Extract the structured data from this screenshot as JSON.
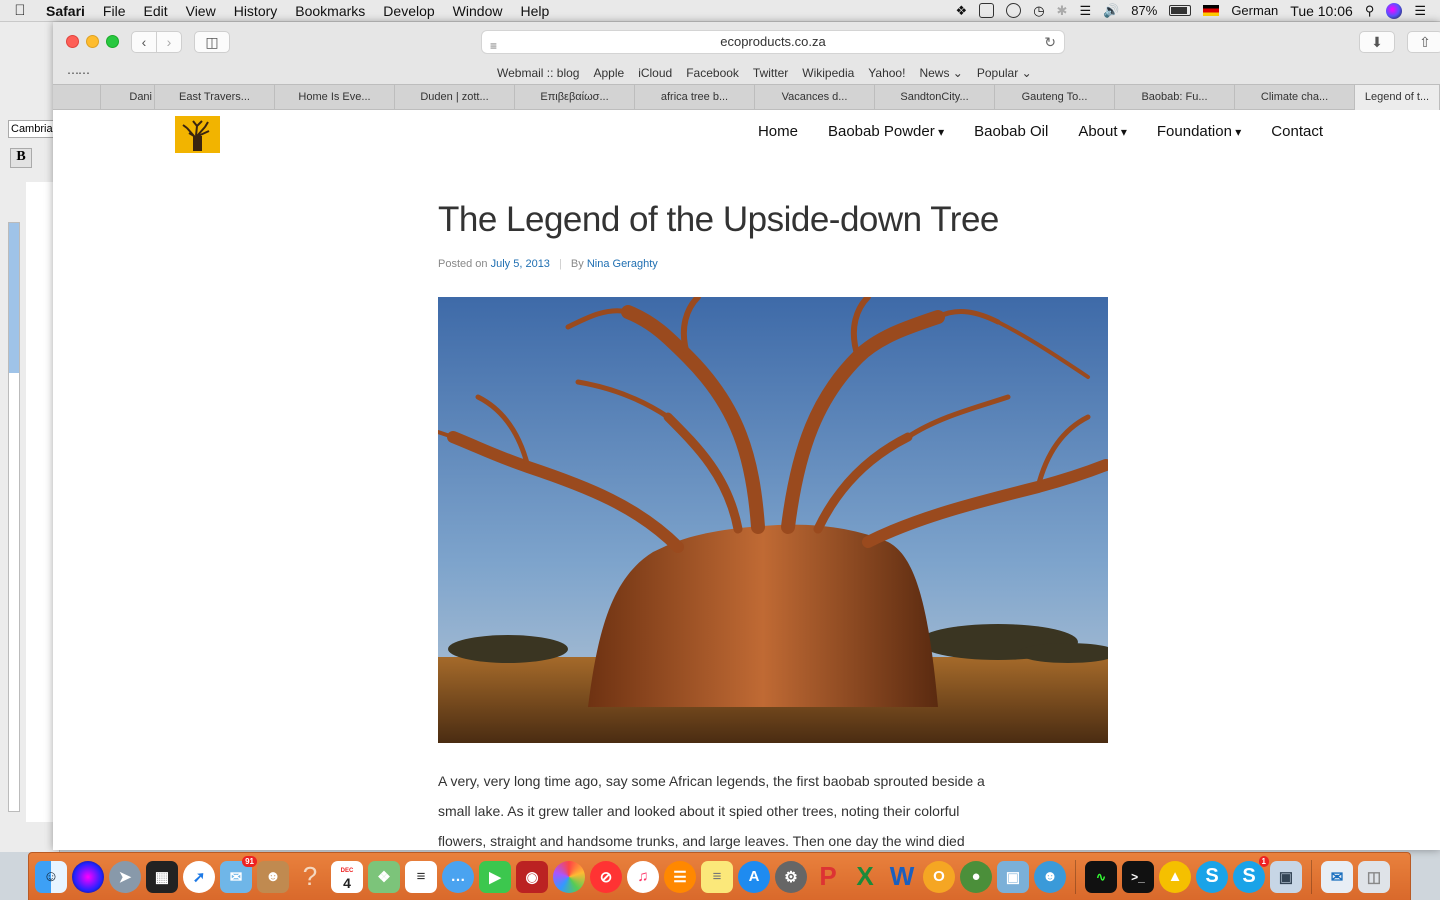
{
  "menubar": {
    "app_name": "Safari",
    "menus": [
      "File",
      "Edit",
      "View",
      "History",
      "Bookmarks",
      "Develop",
      "Window",
      "Help"
    ],
    "battery": "87%",
    "input_language": "German",
    "clock": "Tue 10:06"
  },
  "background_window": {
    "font_box": "Cambria",
    "bold_button": "B"
  },
  "browser": {
    "url": "ecoproducts.co.za",
    "favorites": [
      "Webmail :: blog",
      "Apple",
      "iCloud",
      "Facebook",
      "Twitter",
      "Wikipedia",
      "Yahoo!",
      "News",
      "Popular"
    ],
    "tabs": [
      "Dani",
      "East Travers...",
      "Home Is Eve...",
      "Duden | zott...",
      "Επιβεβαίωσ...",
      "africa tree b...",
      "Vacances d...",
      "SandtonCity...",
      "Gauteng To...",
      "Baobab: Fu...",
      "Climate cha...",
      "Legend of t..."
    ]
  },
  "site": {
    "nav": [
      "Home",
      "Baobab Powder",
      "Baobab Oil",
      "About",
      "Foundation",
      "Contact"
    ],
    "post": {
      "title": "The Legend of the Upside-down Tree",
      "posted_on": "Posted on",
      "date": "July 5, 2013",
      "by": "By",
      "author": "Nina Geraghty",
      "body_lines": [
        "A very, very long time ago, say some African legends, the first baobab sprouted beside a",
        "small lake. As it grew taller and looked about it spied other trees, noting their colorful",
        "flowers, straight and handsome trunks, and large leaves. Then one day the wind died"
      ]
    }
  },
  "dock": {
    "badges": {
      "mail": "91",
      "skype": "1"
    },
    "calendar_day": "4",
    "calendar_month": "DEC",
    "icons": [
      "finder-icon",
      "siri-icon",
      "launchpad-icon",
      "mission-control-icon",
      "safari-icon",
      "mail-icon",
      "contacts-icon",
      "help-icon",
      "calendar-icon",
      "maps-icon",
      "reminders-icon",
      "messages-icon",
      "facetime-icon",
      "photo-booth-icon",
      "photos-icon",
      "news-icon",
      "itunes-icon",
      "ibooks-icon",
      "notes-icon",
      "app-store-icon",
      "system-preferences-icon",
      "powerpoint-icon",
      "excel-icon",
      "word-icon",
      "vlc-icon",
      "network-icon",
      "preview-icon",
      "messenger-icon",
      "activity-monitor-icon",
      "terminal-icon",
      "vpn-icon",
      "skype-icon",
      "skype-alt-icon",
      "image-capture-icon",
      "downloads-icon",
      "trash-icon"
    ]
  }
}
